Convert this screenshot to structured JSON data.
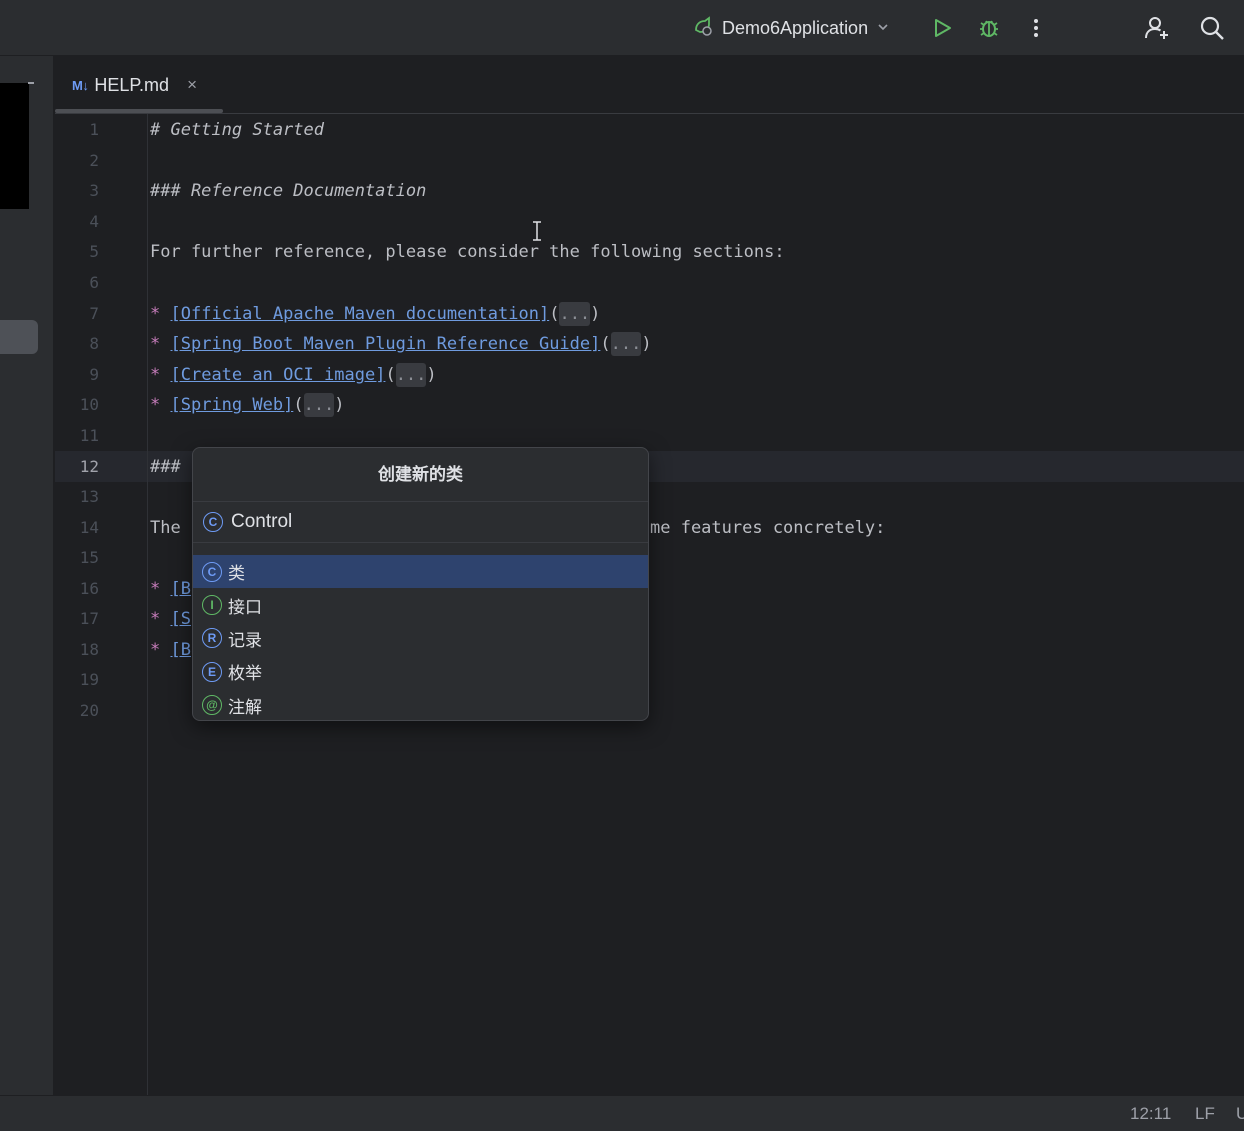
{
  "titlebar": {
    "run_config": "Demo6Application",
    "icons": [
      "run-config-icon",
      "chevron-down-icon",
      "run-icon",
      "debug-icon",
      "more-vertical-icon",
      "add-user-icon",
      "search-icon"
    ]
  },
  "editor": {
    "tab": {
      "badge": "M↓",
      "name": "HELP.md",
      "close": "×"
    },
    "current_line": 12,
    "lines": [
      {
        "num": "1"
      },
      {
        "num": "2"
      },
      {
        "num": "3"
      },
      {
        "num": "4"
      },
      {
        "num": "5"
      },
      {
        "num": "6"
      },
      {
        "num": "7"
      },
      {
        "num": "8"
      },
      {
        "num": "9"
      },
      {
        "num": "10"
      },
      {
        "num": "11"
      },
      {
        "num": "12"
      },
      {
        "num": "13"
      },
      {
        "num": "14"
      },
      {
        "num": "15"
      },
      {
        "num": "16"
      },
      {
        "num": "17"
      },
      {
        "num": "18"
      },
      {
        "num": "19"
      },
      {
        "num": "20"
      }
    ],
    "text": {
      "l1": "# Getting Started",
      "l3": "### Reference Documentation",
      "l5": "For further reference, please consider the following sections:",
      "bullet": "*",
      "l7_link": "[Official Apache Maven documentation]",
      "l8_link": "[Spring Boot Maven Plugin Reference Guide]",
      "l9_link": "[Create an OCI image]",
      "l10_link": "[Spring Web]",
      "fold": "...",
      "paren_open": "(",
      "paren_close": ")",
      "l12": "###",
      "l14_left": "The",
      "l14_right": "me features concretely:",
      "l16_link": "[B",
      "l17_link": "[S",
      "l18_link": "[B"
    }
  },
  "popup": {
    "title": "创建新的类",
    "input_value": "Control",
    "items": [
      {
        "label": "类",
        "icon": "C",
        "color": "#6e9bf5"
      },
      {
        "label": "接口",
        "icon": "I",
        "color": "#5fb865"
      },
      {
        "label": "记录",
        "icon": "R",
        "color": "#6e9bf5"
      },
      {
        "label": "枚举",
        "icon": "E",
        "color": "#6e9bf5"
      },
      {
        "label": "注解",
        "icon": "@",
        "color": "#5fb865"
      }
    ]
  },
  "statusbar": {
    "position": "12:11",
    "line_ending": "LF",
    "encoding_partial": "U"
  },
  "colors": {
    "accent": "#3574f0",
    "selection": "#2e436e",
    "markdown_header": "#c77dbb",
    "link": "#6f9bdf"
  }
}
